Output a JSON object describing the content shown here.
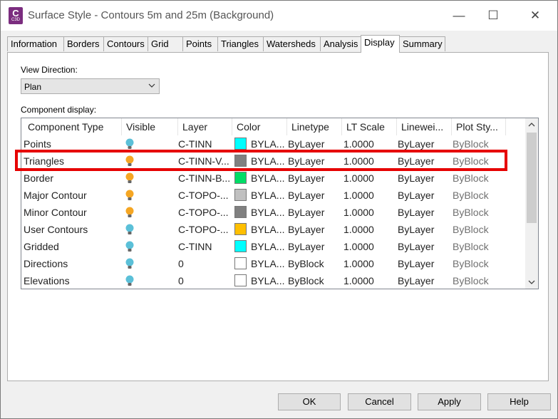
{
  "window": {
    "title": "Surface Style - Contours 5m and 25m (Background)",
    "app_icon_letter": "C",
    "app_icon_sub": "C3D",
    "minimize": "—",
    "maximize": "☐",
    "close": "✕"
  },
  "tabs": [
    {
      "label": "Information"
    },
    {
      "label": "Borders"
    },
    {
      "label": "Contours"
    },
    {
      "label": "Grid"
    },
    {
      "label": "Points"
    },
    {
      "label": "Triangles"
    },
    {
      "label": "Watersheds"
    },
    {
      "label": "Analysis"
    },
    {
      "label": "Display"
    },
    {
      "label": "Summary"
    }
  ],
  "active_tab": "Display",
  "view_direction": {
    "label": "View Direction:",
    "value": "Plan"
  },
  "component_display": {
    "label": "Component display:",
    "columns": [
      "Component Type",
      "Visible",
      "Layer",
      "Color",
      "Linetype",
      "LT Scale",
      "Linewei...",
      "Plot Sty..."
    ],
    "rows": [
      {
        "type": "Points",
        "visible_color": "#5bc0d8",
        "layer": "C-TINN",
        "swatch": "#00ffff",
        "color": "BYLA...",
        "linetype": "ByLayer",
        "lt_scale": "1.0000",
        "lineweight": "ByLayer",
        "plot_style": "ByBlock"
      },
      {
        "type": "Triangles",
        "visible_color": "#f5a623",
        "layer": "C-TINN-V...",
        "swatch": "#808080",
        "color": "BYLA...",
        "linetype": "ByLayer",
        "lt_scale": "1.0000",
        "lineweight": "ByLayer",
        "plot_style": "ByBlock"
      },
      {
        "type": "Border",
        "visible_color": "#f5a623",
        "layer": "C-TINN-B...",
        "swatch": "#00dd66",
        "color": "BYLA...",
        "linetype": "ByLayer",
        "lt_scale": "1.0000",
        "lineweight": "ByLayer",
        "plot_style": "ByBlock"
      },
      {
        "type": "Major Contour",
        "visible_color": "#f5a623",
        "layer": "C-TOPO-...",
        "swatch": "#c0c0c0",
        "color": "BYLA...",
        "linetype": "ByLayer",
        "lt_scale": "1.0000",
        "lineweight": "ByLayer",
        "plot_style": "ByBlock"
      },
      {
        "type": "Minor Contour",
        "visible_color": "#f5a623",
        "layer": "C-TOPO-...",
        "swatch": "#808080",
        "color": "BYLA...",
        "linetype": "ByLayer",
        "lt_scale": "1.0000",
        "lineweight": "ByLayer",
        "plot_style": "ByBlock"
      },
      {
        "type": "User Contours",
        "visible_color": "#5bc0d8",
        "layer": "C-TOPO-...",
        "swatch": "#ffbf00",
        "color": "BYLA...",
        "linetype": "ByLayer",
        "lt_scale": "1.0000",
        "lineweight": "ByLayer",
        "plot_style": "ByBlock"
      },
      {
        "type": "Gridded",
        "visible_color": "#5bc0d8",
        "layer": "C-TINN",
        "swatch": "#00ffff",
        "color": "BYLA...",
        "linetype": "ByLayer",
        "lt_scale": "1.0000",
        "lineweight": "ByLayer",
        "plot_style": "ByBlock"
      },
      {
        "type": "Directions",
        "visible_color": "#5bc0d8",
        "layer": "0",
        "swatch": "#ffffff",
        "color": "BYLA...",
        "linetype": "ByBlock",
        "lt_scale": "1.0000",
        "lineweight": "ByLayer",
        "plot_style": "ByBlock"
      },
      {
        "type": "Elevations",
        "visible_color": "#5bc0d8",
        "layer": "0",
        "swatch": "#ffffff",
        "color": "BYLA...",
        "linetype": "ByBlock",
        "lt_scale": "1.0000",
        "lineweight": "ByLayer",
        "plot_style": "ByBlock"
      }
    ],
    "highlighted_row": "Triangles",
    "highlight_color": "#e60000"
  },
  "buttons": {
    "ok": "OK",
    "cancel": "Cancel",
    "apply": "Apply",
    "help": "Help"
  }
}
